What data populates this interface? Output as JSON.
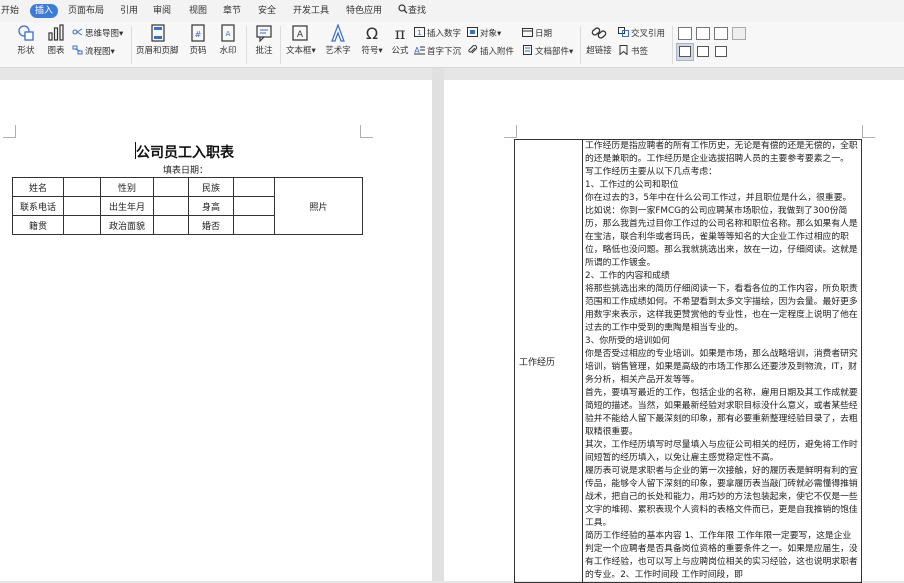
{
  "menu": {
    "items": [
      "开始",
      "插入",
      "页面布局",
      "引用",
      "审阅",
      "视图",
      "章节",
      "安全",
      "开发工具",
      "特色应用",
      "查找"
    ],
    "active_index": 1
  },
  "ribbon": {
    "shape_label": "形状",
    "chart_label": "图表",
    "mindmap_label": "思维导图",
    "flowchart_label": "流程图",
    "header_footer_label": "页眉和页脚",
    "page_number_label": "页码",
    "watermark_label": "水印",
    "comment_label": "批注",
    "textbox_label": "文本框",
    "art_text_label": "艺术字",
    "symbol_label": "符号",
    "formula_label": "公式",
    "insert_number_label": "插入数字",
    "object_label": "对象",
    "date_label": "日期",
    "drop_cap_label": "首字下沉",
    "attachment_label": "插入附件",
    "doc_parts_label": "文档部件",
    "hyperlink_label": "超链接",
    "cross_ref_label": "交叉引用",
    "bookmark_label": "书签"
  },
  "document": {
    "form_title": "公司员工入职表",
    "fill_date_label": "填表日期：",
    "rows": [
      [
        "姓名",
        "",
        "性别",
        "",
        "民族",
        ""
      ],
      [
        "联系电话",
        "",
        "出生年月",
        "",
        "身高",
        ""
      ],
      [
        "籍贯",
        "",
        "政治面貌",
        "",
        "婚否",
        ""
      ]
    ],
    "photo_label": "照片",
    "experience_label": "工作经历",
    "experience_text": "工作经历是指应聘者的所有工作历史，无论是有偿的还是无偿的，全职的还是兼职的。工作经历是企业选拔招聘人员的主要参考要素之一。\n写工作经历主要从以下几点考虑：\n1、工作过的公司和职位\n你在过去的3，5年中在什么公司工作过，并且职位是什么，很重要。比如说：你到一家FMCG的公司应聘某市场职位，我做到了300份简历，那么我首先过目你工作过的公司名称和职位名称。那么如果有人是在宝洁，联合利华或者玛氏，雀巢等等知名的大企业工作过相应的职位，略低也没问题。那么我就挑选出来，放在一边，仔细阅读。这就是所谓的工作镀金。\n2、工作的内容和成绩\n将那些挑选出来的简历仔细阅读一下，看看各位的工作内容，所负职责范围和工作成绩如何。不希望看到太多文字描绘，因为会量。最好更多用数字来表示，这样我更赞赏他的专业性，也在一定程度上说明了他在过去的工作中受到的熏陶是相当专业的。\n3、你所受的培训如何\n你是否受过相应的专业培训。如果是市场，那么战略培训，消费者研究培训，销售管理，如果是高级的市场工作那么还要涉及到物流，IT，财务分析，相关产品开发等等。\n首先，要填写最近的工作，包括企业的名称，雇用日期及其工作成就要简短的描述。当然，如果最新经验对求职目标没什么意义，或者某些经验并不能给人留下最深刻的印象，那有必要重新整理经验目录了，去粗取精很重要。\n其次，工作经历填写时尽量填入与应征公司相关的经历，避免将工作时间短暂的经历填入，以免让雇主感觉稳定性不高。\n履历表可说是求职者与企业的第一次接触，好的履历表是鲜明有利的宣传品，能够令人留下深刻的印象，要拿履历表当敲门砖就必需懂得推销战术，把自己的长处和能力，用巧妙的方法包装起来，使它不仅是一些文字的堆砌、累积表现个人资料的表格文件而已，更是自我推销的饱佳工具。\n简历工作经验的基本内容 1、工作年限 工作年限一定要写，这是企业判定一个应聘者是否具备岗位资格的重要条件之一。如果是应届生，没有工作经验，也可以写上与应聘岗位相关的实习经验，这也说明求职者的专业。2、工作时间段 工作时间段，即"
  },
  "colors": {
    "accent": "#3d7bd9",
    "menubar_bg": "#f3f3f3",
    "ribbon_bg": "#f7f7f7",
    "canvas_bg": "#e6e6e6",
    "icon_blue": "#3a6fc7"
  }
}
